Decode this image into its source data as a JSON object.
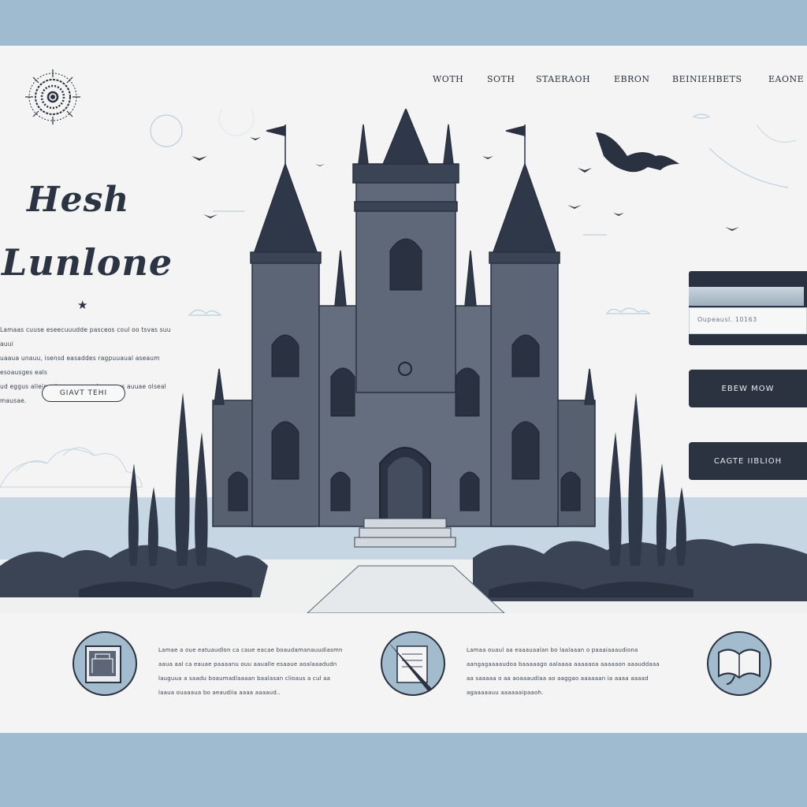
{
  "nav": {
    "items": [
      "WOTH",
      "SOTH",
      "STAERAOH",
      "EBRON",
      "BEINIEHBETS",
      "EAONE"
    ]
  },
  "hero": {
    "title_line1": "Hesh",
    "title_line2": "Lunlone",
    "star": "★",
    "paragraph_lines": [
      "Lamaas cuuse eseecuuudde pasceos coul oo tsvas suu auui",
      "uaaua unauu, isensd easaddes ragpuuaual aseaum esoausges eals",
      "ud eggus alleinual cu euauaes luaguaus auuae olseal mausae."
    ],
    "cta_label": "GIAVT TEHI"
  },
  "sidebar_right": {
    "input_placeholder": "Oupeausl. 10163",
    "button1_label": "EBEW MOW",
    "button2_label": "CAGTE IIBLIOH"
  },
  "features": [
    {
      "icon": "library-book-icon",
      "lines": [
        "Lamae a oue eatuaudlon ca caue eacae boaudamanauudiasmn",
        "aaua aal ca eauae paaaanu ouu aaualle esaaue aoalaaadudn",
        "lauguua a saadu boaumadlaaaan baalasan clioaus a cul aa",
        "laaua ouaaaua bo aeaudiia aaaa aaaaud.."
      ]
    },
    {
      "icon": "quill-pen-icon",
      "lines": [
        "Lamaa ouaul aa eaaauaalan bo laalaaan o paaaiaaaudiona",
        "aangagaaaaudoa baaaaago aalaaaa aaaaaoa aaaaaon aaauddaaa",
        "aa saaaaa o aa aoaaaudiaa ao aaggao aaaaaan ia aaaa aaaad",
        "agaaaaauu aaaaaaipaaoh."
      ]
    },
    {
      "icon": "open-book-icon",
      "lines": []
    }
  ],
  "colors": {
    "frame": "#9fbbd0",
    "page": "#f3f4f3",
    "ink": "#2a3140",
    "sea": "#b7cede"
  }
}
